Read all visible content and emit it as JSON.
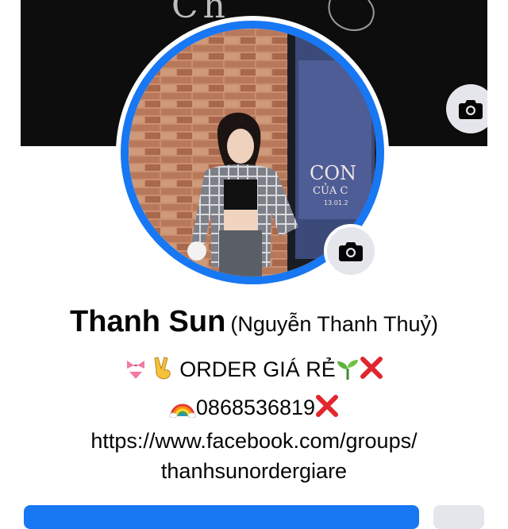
{
  "cover": {
    "text": "Ch",
    "camera_icon": "camera-icon"
  },
  "avatar": {
    "camera_icon": "camera-icon",
    "story_ring_color": "#1877f2",
    "poster_text_1": "CON",
    "poster_text_2": "CỦA C",
    "poster_text_3": "13.01.2"
  },
  "profile": {
    "name": "Thanh Sun",
    "alternate_name": "(Nguyễn Thanh Thuỷ)"
  },
  "bio": {
    "line1_text": "ORDER GIÁ RẺ",
    "line2_text": "0868536819",
    "link_line1": "https://www.facebook.com/groups/",
    "link_line2": "thanhsunordergiare",
    "emojis": [
      "bikini-emoji",
      "victory-hand-emoji",
      "seedling-emoji",
      "cross-mark-emoji",
      "rainbow-emoji",
      "cross-mark-emoji"
    ]
  },
  "colors": {
    "accent": "#1877f2",
    "button_secondary": "#e4e6eb",
    "cross": "#e0262e"
  }
}
